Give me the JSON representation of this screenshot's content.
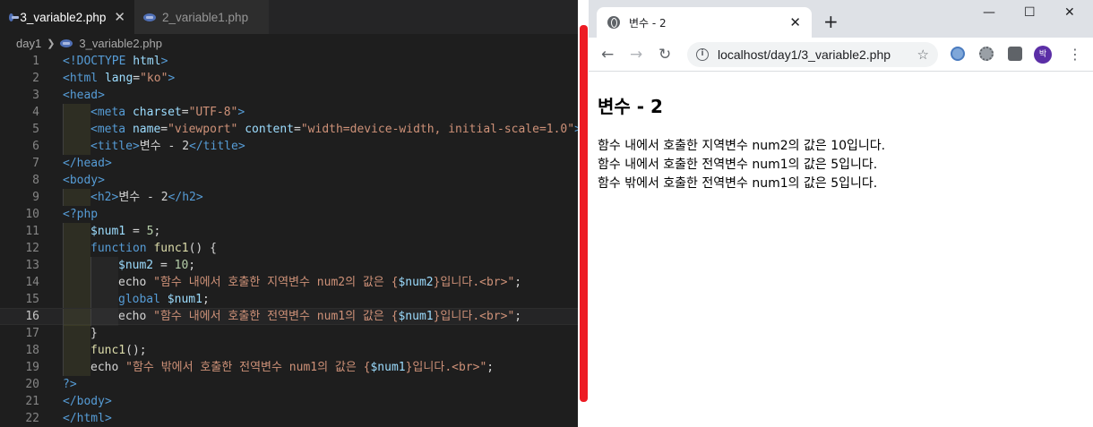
{
  "editor": {
    "tabs": [
      {
        "label": "3_variable2.php",
        "active": true
      },
      {
        "label": "2_variable1.php",
        "active": false
      }
    ],
    "tab_close": "✕",
    "breadcrumb": {
      "folder": "day1",
      "file": "3_variable2.php"
    },
    "current_line": 16,
    "lines": [
      {
        "n": "1",
        "indent": 0
      },
      {
        "n": "2",
        "indent": 0
      },
      {
        "n": "3",
        "indent": 0
      },
      {
        "n": "4",
        "indent": 1
      },
      {
        "n": "5",
        "indent": 1
      },
      {
        "n": "6",
        "indent": 1
      },
      {
        "n": "7",
        "indent": 0
      },
      {
        "n": "8",
        "indent": 0
      },
      {
        "n": "9",
        "indent": 1
      },
      {
        "n": "10",
        "indent": 0
      },
      {
        "n": "11",
        "indent": 1
      },
      {
        "n": "12",
        "indent": 1
      },
      {
        "n": "13",
        "indent": 2
      },
      {
        "n": "14",
        "indent": 2
      },
      {
        "n": "15",
        "indent": 2
      },
      {
        "n": "16",
        "indent": 2
      },
      {
        "n": "17",
        "indent": 1
      },
      {
        "n": "18",
        "indent": 1
      },
      {
        "n": "19",
        "indent": 1
      },
      {
        "n": "20",
        "indent": 0
      },
      {
        "n": "21",
        "indent": 0
      },
      {
        "n": "22",
        "indent": 0
      }
    ],
    "code": [
      [
        [
          "tg",
          "<!DOCTYPE "
        ],
        [
          "at",
          "html"
        ],
        [
          "tg",
          ">"
        ]
      ],
      [
        [
          "tg",
          "<html "
        ],
        [
          "at",
          "lang"
        ],
        [
          "tx",
          "="
        ],
        [
          "st",
          "\"ko\""
        ],
        [
          "tg",
          ">"
        ]
      ],
      [
        [
          "tg",
          "<head>"
        ]
      ],
      [
        [
          "tg",
          "<meta "
        ],
        [
          "at",
          "charset"
        ],
        [
          "tx",
          "="
        ],
        [
          "st",
          "\"UTF-8\""
        ],
        [
          "tg",
          ">"
        ]
      ],
      [
        [
          "tg",
          "<meta "
        ],
        [
          "at",
          "name"
        ],
        [
          "tx",
          "="
        ],
        [
          "st",
          "\"viewport\""
        ],
        [
          "tx",
          " "
        ],
        [
          "at",
          "content"
        ],
        [
          "tx",
          "="
        ],
        [
          "st",
          "\"width=device-width, initial-scale=1.0\""
        ],
        [
          "tg",
          ">"
        ]
      ],
      [
        [
          "tg",
          "<title>"
        ],
        [
          "tx",
          "변수 - 2"
        ],
        [
          "tg",
          "</title>"
        ]
      ],
      [
        [
          "tg",
          "</head>"
        ]
      ],
      [
        [
          "tg",
          "<body>"
        ]
      ],
      [
        [
          "tg",
          "<h2>"
        ],
        [
          "tx",
          "변수 - 2"
        ],
        [
          "tg",
          "</h2>"
        ]
      ],
      [
        [
          "ph",
          "<?php"
        ]
      ],
      [
        [
          "at",
          "$num1"
        ],
        [
          "tx",
          " = "
        ],
        [
          "nm",
          "5"
        ],
        [
          "tx",
          ";"
        ]
      ],
      [
        [
          "kw",
          "function "
        ],
        [
          "fn",
          "func1"
        ],
        [
          "tx",
          "() {"
        ]
      ],
      [
        [
          "at",
          "$num2"
        ],
        [
          "tx",
          " = "
        ],
        [
          "nm",
          "10"
        ],
        [
          "tx",
          ";"
        ]
      ],
      [
        [
          "tx",
          "echo "
        ],
        [
          "st",
          "\"함수 내에서 호출한 지역변수 num2의 값은 {"
        ],
        [
          "at",
          "$num2"
        ],
        [
          "st",
          "}입니다.<br>\""
        ],
        [
          "tx",
          ";"
        ]
      ],
      [
        [
          "kw",
          "global "
        ],
        [
          "at",
          "$num1"
        ],
        [
          "tx",
          ";"
        ]
      ],
      [
        [
          "tx",
          "echo "
        ],
        [
          "st",
          "\"함수 내에서 호출한 전역변수 num1의 값은 {"
        ],
        [
          "at",
          "$num1"
        ],
        [
          "st",
          "}입니다.<br>\""
        ],
        [
          "tx",
          ";"
        ]
      ],
      [
        [
          "tx",
          "}"
        ]
      ],
      [
        [
          "fn",
          "func1"
        ],
        [
          "tx",
          "();"
        ]
      ],
      [
        [
          "tx",
          "echo "
        ],
        [
          "st",
          "\"함수 밖에서 호출한 전역변수 num1의 값은 {"
        ],
        [
          "at",
          "$num1"
        ],
        [
          "st",
          "}입니다.<br>\""
        ],
        [
          "tx",
          ";"
        ]
      ],
      [
        [
          "ph",
          "?>"
        ]
      ],
      [
        [
          "tg",
          "</body>"
        ]
      ],
      [
        [
          "tg",
          "</html>"
        ]
      ]
    ]
  },
  "browser": {
    "tab_title": "변수 - 2",
    "tab_close": "✕",
    "new_tab": "+",
    "window_controls": {
      "minimize": "—",
      "maximize": "☐",
      "close": "✕"
    },
    "nav": {
      "back": "←",
      "forward": "→",
      "reload": "↻"
    },
    "url": "localhost/day1/3_variable2.php",
    "star": "☆",
    "profile_initial": "박",
    "menu": "⋮",
    "page": {
      "heading": "변수 - 2",
      "output_lines": [
        "함수 내에서 호출한 지역변수 num2의 값은 10입니다.",
        "함수 내에서 호출한 전역변수 num1의 값은 5입니다.",
        "함수 밖에서 호출한 전역변수 num1의 값은 5입니다."
      ]
    }
  },
  "colors": {
    "divider_accent": "#ed1c24",
    "editor_bg": "#1e1e1e",
    "browser_frame": "#dee1e6",
    "profile": "#5b2ea6"
  }
}
